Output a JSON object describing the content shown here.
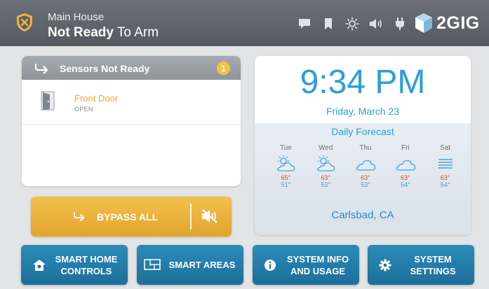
{
  "header": {
    "location": "Main House",
    "status_bold": "Not Ready",
    "status_rest": " To Arm",
    "brand": "2GIG",
    "icons": [
      "message-icon",
      "bookmark-icon",
      "brightness-icon",
      "volume-icon",
      "plug-icon"
    ]
  },
  "sensors": {
    "title": "Sensors Not Ready",
    "count": "1",
    "items": [
      {
        "name": "Front Door",
        "state": "OPEN"
      }
    ]
  },
  "bypass": {
    "label": "BYPASS ALL"
  },
  "clock": {
    "time": "9:34 PM",
    "date": "Friday, March 23"
  },
  "forecast": {
    "title": "Daily Forecast",
    "days": [
      {
        "name": "Tue",
        "hi": "65°",
        "lo": "51°",
        "icon": "partly-sunny-icon"
      },
      {
        "name": "Wed",
        "hi": "63°",
        "lo": "53°",
        "icon": "partly-sunny-icon"
      },
      {
        "name": "Thu",
        "hi": "63°",
        "lo": "53°",
        "icon": "cloud-icon"
      },
      {
        "name": "Fri",
        "hi": "63°",
        "lo": "54°",
        "icon": "cloud-icon"
      },
      {
        "name": "Sat",
        "hi": "63°",
        "lo": "54°",
        "icon": "fog-icon"
      }
    ],
    "location": "Carlsbad, CA"
  },
  "bottom": {
    "smart_home": "SMART HOME CONTROLS",
    "smart_areas": "SMART AREAS",
    "system_info": "SYSTEM INFO AND USAGE",
    "system_settings": "SYSTEM SETTINGS"
  },
  "colors": {
    "accent_blue": "#2a9fd6",
    "warning_orange": "#f0a734",
    "bypass_yellow": "#f3c04d",
    "button_blue": "#2c8bb8",
    "hi_temp": "#d84a3b",
    "lo_temp": "#3b9ed8"
  }
}
